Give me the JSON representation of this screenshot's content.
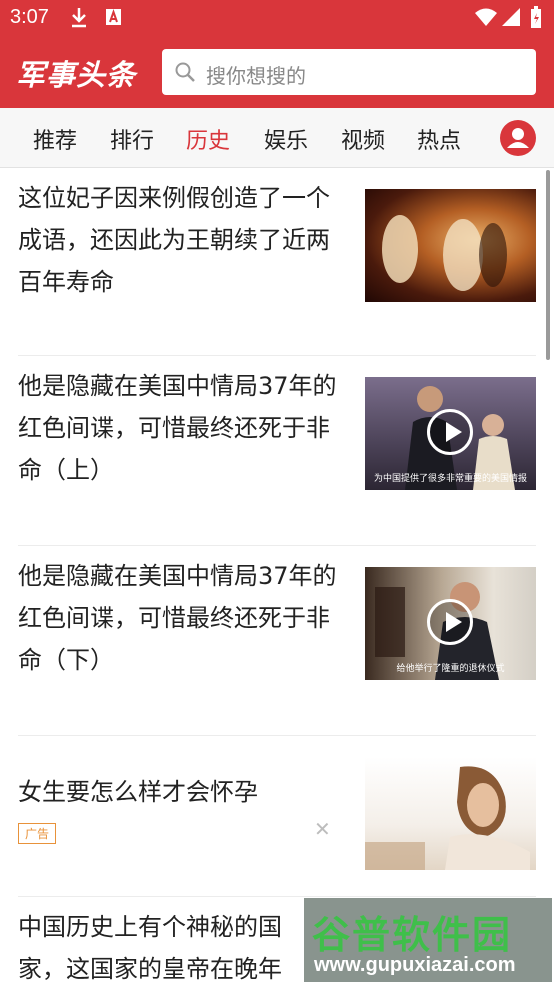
{
  "status_bar": {
    "time": "3:07"
  },
  "header": {
    "logo": "军事头条",
    "search_placeholder": "搜你想搜的"
  },
  "tabs": [
    {
      "label": "推荐"
    },
    {
      "label": "排行"
    },
    {
      "label": "历史",
      "active": true
    },
    {
      "label": "娱乐"
    },
    {
      "label": "视频"
    },
    {
      "label": "热点"
    }
  ],
  "feed": [
    {
      "title": "这位妃子因来例假创造了一个成语，还因此为王朝续了近两百年寿命"
    },
    {
      "title": "他是隐藏在美国中情局37年的红色间谍，可惜最终还死于非命（上）",
      "thumb_caption": "为中国提供了很多非常重要的美国情报"
    },
    {
      "title": "他是隐藏在美国中情局37年的红色间谍，可惜最终还死于非命（下）",
      "thumb_caption": "给他举行了隆重的退休仪式"
    },
    {
      "title": "女生要怎么样才会怀孕",
      "ad_label": "广告"
    },
    {
      "title": "中国历史上有个神秘的国家，这国家的皇帝在晚年"
    }
  ],
  "watermark": {
    "logo": "谷普软件园",
    "url": "www.gupuxiazai.com"
  },
  "colors": {
    "brand": "#d9363b",
    "active_tab": "#d9363b"
  }
}
